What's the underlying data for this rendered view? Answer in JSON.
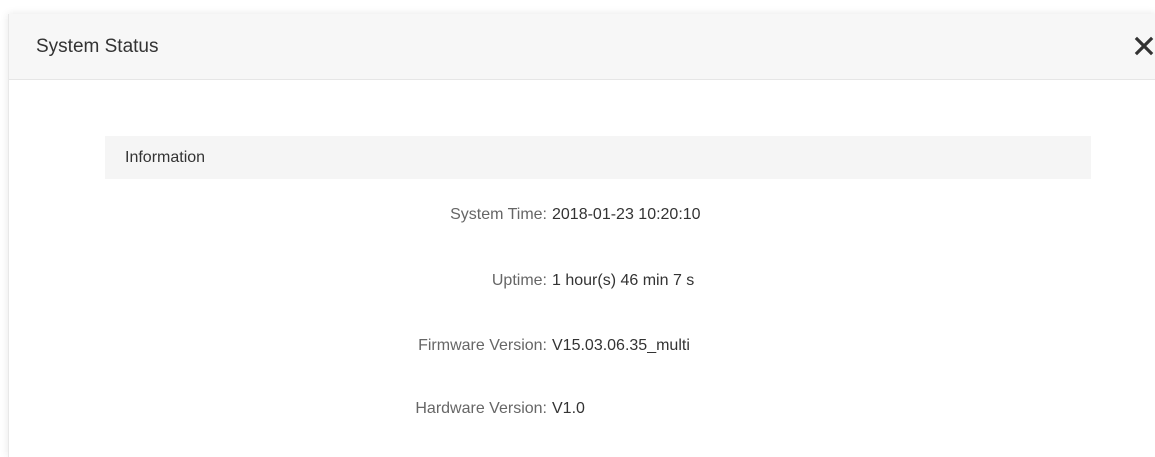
{
  "dialog": {
    "title": "System Status",
    "close_icon": "close-icon"
  },
  "section": {
    "title": "Information"
  },
  "info": [
    {
      "label": "System Time:",
      "value": "2018-01-23 10:20:10"
    },
    {
      "label": "Uptime:",
      "value": "1 hour(s) 46 min 7 s"
    },
    {
      "label": "Firmware Version:",
      "value": "V15.03.06.35_multi"
    },
    {
      "label": "Hardware Version:",
      "value": "V1.0"
    }
  ]
}
